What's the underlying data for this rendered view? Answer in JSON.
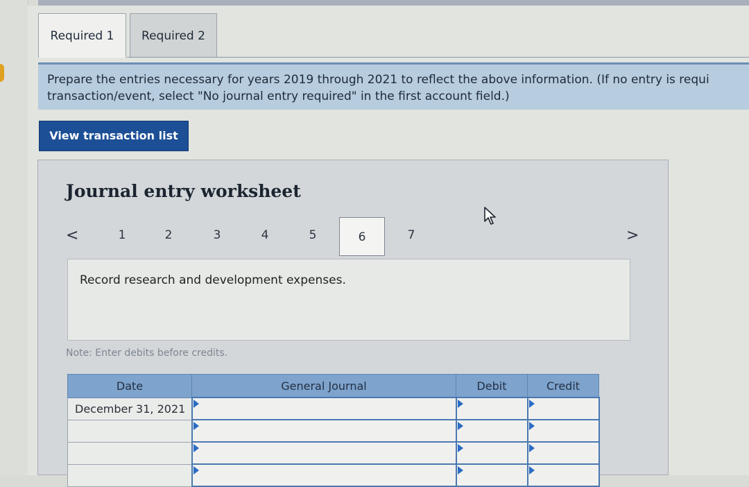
{
  "tabs": [
    {
      "label": "Required 1"
    },
    {
      "label": "Required 2"
    }
  ],
  "instructions": {
    "line1": "Prepare the entries necessary for years 2019 through 2021 to reflect the above information. (If no entry is requi",
    "line2": "transaction/event, select \"No journal entry required\" in the first account field.)"
  },
  "view_button": {
    "label": "View transaction list"
  },
  "worksheet": {
    "title": "Journal entry worksheet",
    "prev": "<",
    "next": ">",
    "pages": [
      "1",
      "2",
      "3",
      "4",
      "5",
      "6",
      "7"
    ],
    "active_page": "6",
    "description": "Record research and development expenses.",
    "note": "Note: Enter debits before credits."
  },
  "journal": {
    "headers": {
      "date": "Date",
      "account": "General Journal",
      "debit": "Debit",
      "credit": "Credit"
    },
    "rows": [
      {
        "date": "December 31, 2021",
        "account": "",
        "debit": "",
        "credit": ""
      },
      {
        "date": "",
        "account": "",
        "debit": "",
        "credit": ""
      },
      {
        "date": "",
        "account": "",
        "debit": "",
        "credit": ""
      },
      {
        "date": "",
        "account": "",
        "debit": "",
        "credit": ""
      }
    ]
  },
  "icons": {
    "cursor": "mouse-pointer-icon",
    "prev": "chevron-left-icon",
    "next": "chevron-right-icon"
  },
  "colors": {
    "button": "#1c4f96",
    "instruction_bg": "#b7ccde",
    "table_header": "#7ea3cc",
    "tab_active": "#f0f1ee"
  }
}
